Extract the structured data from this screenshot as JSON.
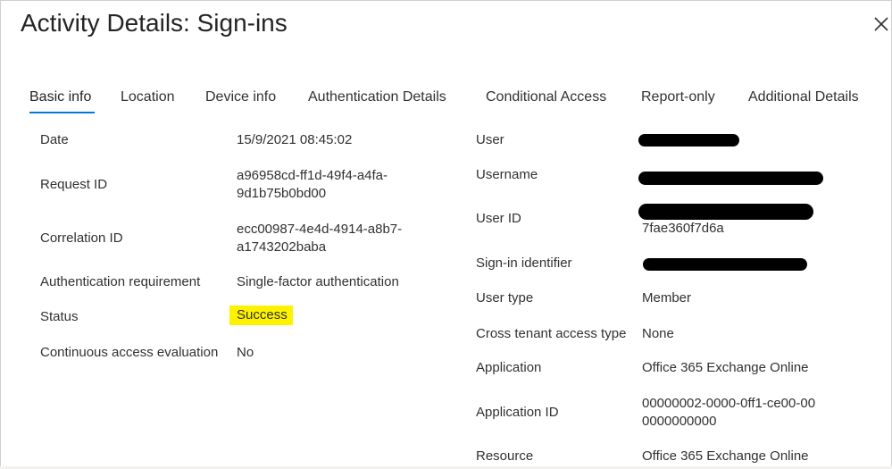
{
  "title": "Activity Details: Sign-ins",
  "tabs": [
    {
      "label": "Basic info",
      "active": true
    },
    {
      "label": "Location"
    },
    {
      "label": "Device info"
    },
    {
      "label": "Authentication Details"
    },
    {
      "label": "Conditional Access"
    },
    {
      "label": "Report-only"
    },
    {
      "label": "Additional Details"
    }
  ],
  "left": [
    {
      "label": "Date",
      "value": "15/9/2021 08:45:02"
    },
    {
      "label": "Request ID",
      "value": "a96958cd-ff1d-49f4-a4fa-9d1b75b0bd00"
    },
    {
      "label": "Correlation ID",
      "value": "ecc00987-4e4d-4914-a8b7-a1743202baba"
    },
    {
      "label": "Authentication requirement",
      "value": "Single-factor authentication"
    },
    {
      "label": "Status",
      "value": "Success"
    },
    {
      "label": "Continuous access evaluation",
      "value": "No"
    }
  ],
  "right": [
    {
      "label": "User",
      "value": "",
      "redacted": true
    },
    {
      "label": "Username",
      "value": "",
      "redacted": true
    },
    {
      "label": "User ID",
      "value": "7fae360f7d6a",
      "redacted": true
    },
    {
      "label": "Sign-in identifier",
      "value": "",
      "redacted": true
    },
    {
      "label": "User type",
      "value": "Member"
    },
    {
      "label": "Cross tenant access type",
      "value": "None"
    },
    {
      "label": "Application",
      "value": "Office 365 Exchange Online"
    },
    {
      "label": "Application ID",
      "value": "00000002-0000-0ff1-ce00-000000000000"
    },
    {
      "label": "Resource",
      "value": "Office 365 Exchange Online"
    }
  ],
  "colors": {
    "accent": "#0078d4",
    "highlight": "#fff200",
    "redaction": "#000000"
  },
  "icons": {
    "close": "close-icon"
  }
}
